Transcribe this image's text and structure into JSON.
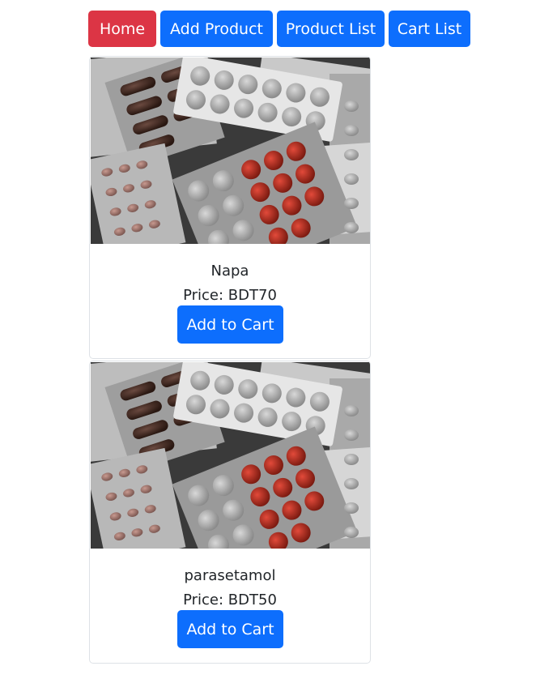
{
  "nav": {
    "home_label": "Home",
    "add_product_label": "Add Product",
    "product_list_label": "Product List",
    "cart_list_label": "Cart List"
  },
  "products": [
    {
      "name": "Napa",
      "price": "Price: BDT70",
      "button_label": "Add to Cart",
      "image": "medicine-blister-packs-photo"
    },
    {
      "name": "parasetamol",
      "price": "Price: BDT50",
      "button_label": "Add to Cart",
      "image": "medicine-blister-packs-photo"
    }
  ],
  "colors": {
    "primary": "#0d6efd",
    "danger": "#dc3545",
    "border": "#dee2e6"
  }
}
